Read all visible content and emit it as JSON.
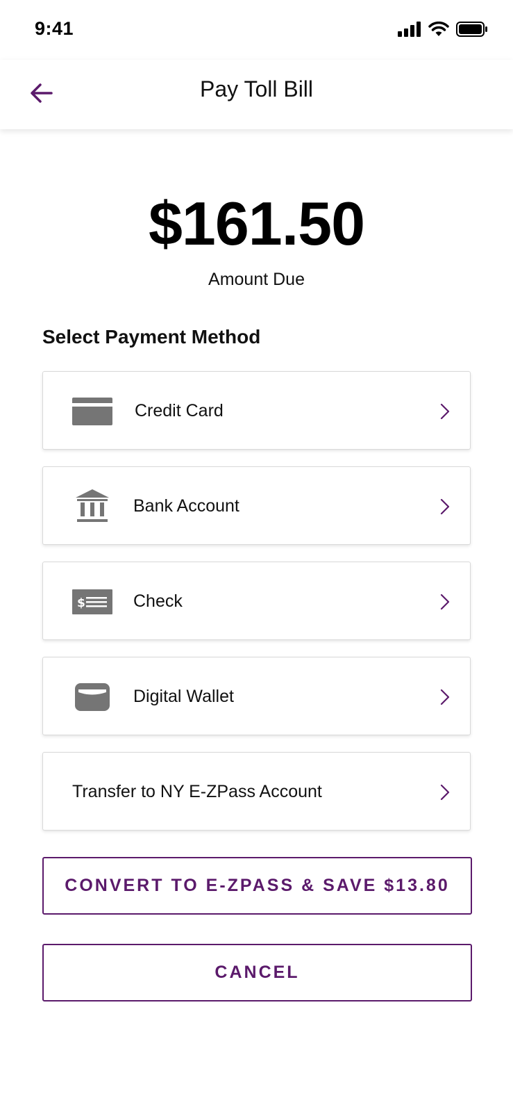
{
  "status_bar": {
    "time": "9:41",
    "icons": [
      "cellular-signal-icon",
      "wifi-icon",
      "battery-icon"
    ]
  },
  "header": {
    "back_icon": "arrow-left-icon",
    "title": "Pay Toll Bill"
  },
  "summary": {
    "amount": "$161.50",
    "amount_label": "Amount Due"
  },
  "payment": {
    "section_title": "Select Payment Method",
    "methods": [
      {
        "label": "Credit Card",
        "icon": "credit-card-icon"
      },
      {
        "label": "Bank Account",
        "icon": "bank-icon"
      },
      {
        "label": "Check",
        "icon": "check-icon"
      },
      {
        "label": "Digital Wallet",
        "icon": "wallet-icon"
      },
      {
        "label": "Transfer to NY E-ZPass Account",
        "icon": ""
      }
    ]
  },
  "actions": {
    "convert_label": "CONVERT TO E-ZPASS & SAVE $13.80",
    "cancel_label": "CANCEL"
  },
  "colors": {
    "accent": "#5b1a6b",
    "icon_gray": "#757575",
    "card_border": "#d9d9d9"
  }
}
